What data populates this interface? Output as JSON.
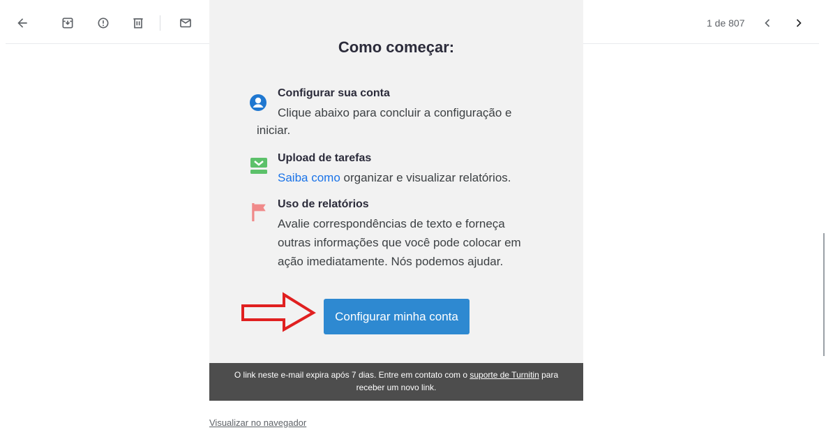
{
  "toolbar": {
    "icons": [
      "back-icon",
      "archive-icon",
      "report-spam-icon",
      "delete-icon",
      "mark-unread-icon",
      "snooze-icon",
      "add-to-tasks-icon",
      "move-to-icon",
      "label-icon",
      "more-icon"
    ],
    "pager": "1 de 807"
  },
  "email": {
    "title": "Como começar:",
    "items": [
      {
        "icon": "account-icon",
        "title": "Configurar sua conta",
        "line1": "Clique abaixo para concluir a configuração e",
        "line2": "iniciar.",
        "icon_color": "#1f77d0"
      },
      {
        "icon": "upload-tray-icon",
        "title": "Upload de tarefas",
        "link": "Saiba como",
        "text": " organizar e visualizar relatórios.",
        "icon_color": "#5cc16a"
      },
      {
        "icon": "flag-icon",
        "title": "Uso de relatórios",
        "line1": "Avalie correspondências de texto e forneça",
        "line2": "outras informações que você pode colocar em",
        "line3": "ação imediatamente. Nós podemos ajudar.",
        "icon_color": "#f08a8a"
      }
    ],
    "cta_label": "Configurar minha conta",
    "footer_pre": "O link neste e-mail expira após 7 dias. Entre em contato com o ",
    "footer_link": "suporte de Turnitin",
    "footer_post": " para",
    "footer_line2": "receber um novo link.",
    "browser_link": "Visualizar no navegador"
  },
  "colors": {
    "accent": "#2e89d1",
    "arrow": "#e02020",
    "footer_bg": "#4d4d4d"
  }
}
